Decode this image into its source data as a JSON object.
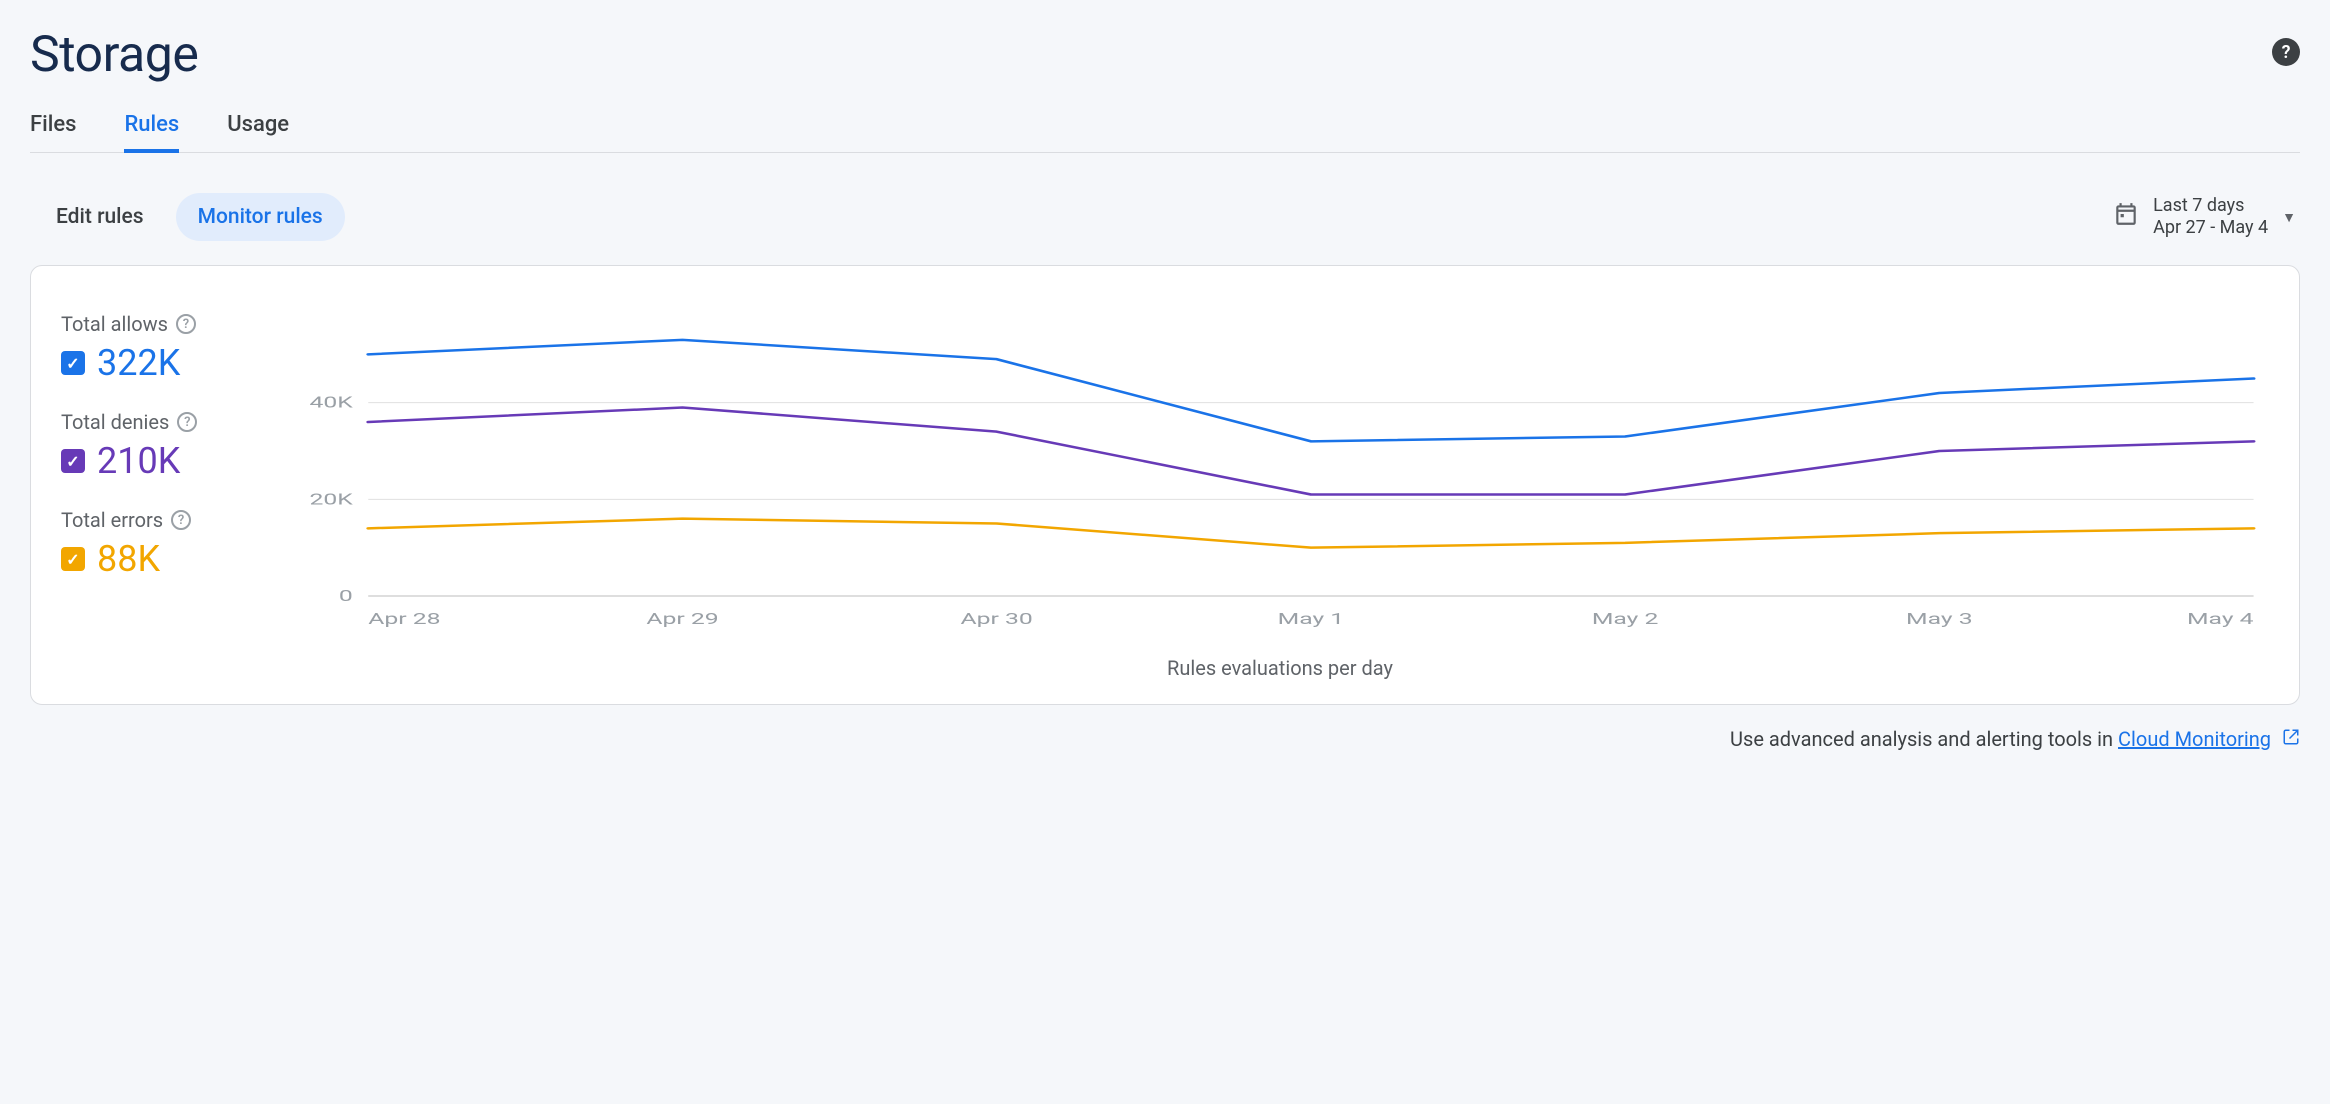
{
  "page": {
    "title": "Storage",
    "help_tooltip": "Help"
  },
  "tabs": [
    {
      "id": "files",
      "label": "Files",
      "active": false
    },
    {
      "id": "rules",
      "label": "Rules",
      "active": true
    },
    {
      "id": "usage",
      "label": "Usage",
      "active": false
    }
  ],
  "subtabs": [
    {
      "id": "edit",
      "label": "Edit rules",
      "active": false
    },
    {
      "id": "monitor",
      "label": "Monitor rules",
      "active": true
    }
  ],
  "date_range": {
    "label": "Last 7 days",
    "dates": "Apr 27 - May 4"
  },
  "legend": {
    "allows": {
      "label": "Total allows",
      "value": "322K",
      "checked": true
    },
    "denies": {
      "label": "Total denies",
      "value": "210K",
      "checked": true
    },
    "errors": {
      "label": "Total errors",
      "value": "88K",
      "checked": true
    }
  },
  "chart_data": {
    "type": "line",
    "title": "",
    "xlabel": "Rules evaluations per day",
    "ylabel": "",
    "ylim": [
      0,
      60000
    ],
    "yticks": [
      0,
      20000,
      40000
    ],
    "ytick_labels": [
      "0",
      "20K",
      "40K"
    ],
    "categories": [
      "Apr 28",
      "Apr 29",
      "Apr 30",
      "May 1",
      "May 2",
      "May 3",
      "May 4"
    ],
    "series": [
      {
        "name": "Total allows",
        "color": "#1a73e8",
        "values": [
          50000,
          53000,
          49000,
          32000,
          33000,
          42000,
          45000
        ]
      },
      {
        "name": "Total denies",
        "color": "#673ab7",
        "values": [
          36000,
          39000,
          34000,
          21000,
          21000,
          30000,
          32000
        ]
      },
      {
        "name": "Total errors",
        "color": "#f2a600",
        "values": [
          14000,
          16000,
          15000,
          10000,
          11000,
          13000,
          14000
        ]
      }
    ]
  },
  "footer": {
    "prefix": "Use advanced analysis and alerting tools in ",
    "link_text": "Cloud Monitoring"
  }
}
